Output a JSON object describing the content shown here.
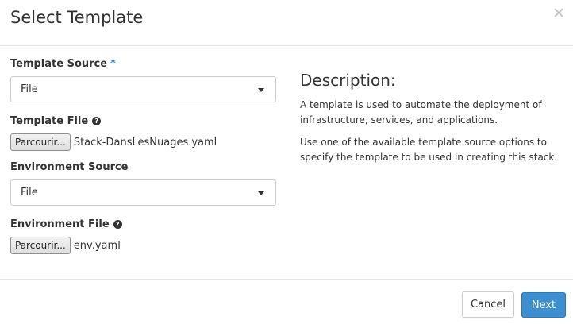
{
  "header": {
    "title": "Select Template",
    "close_glyph": "✕"
  },
  "form": {
    "template_source": {
      "label": "Template Source",
      "required_mark": "*",
      "selected": "File"
    },
    "template_file": {
      "label": "Template File",
      "help_glyph": "?",
      "browse_label": "Parcourir...",
      "file_name": "Stack-DansLesNuages.yaml"
    },
    "environment_source": {
      "label": "Environment Source",
      "selected": "File"
    },
    "environment_file": {
      "label": "Environment File",
      "help_glyph": "?",
      "browse_label": "Parcourir...",
      "file_name": "env.yaml"
    }
  },
  "description": {
    "title": "Description:",
    "paragraphs": [
      "A template is used to automate the deployment of infrastructure, services, and applications.",
      "Use one of the available template source options to specify the template to be used in creating this stack."
    ]
  },
  "footer": {
    "cancel_label": "Cancel",
    "next_label": "Next"
  },
  "colors": {
    "primary": "#3d8fd1",
    "required": "#2d7fc7",
    "border": "#cccccc"
  }
}
